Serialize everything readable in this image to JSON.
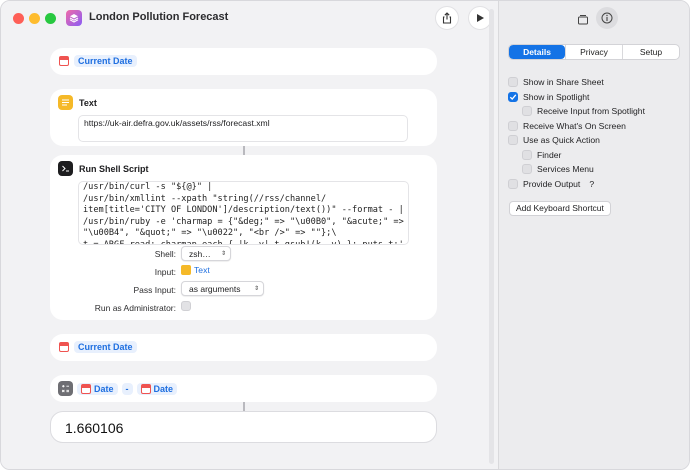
{
  "window": {
    "title": "London Pollution Forecast"
  },
  "actions": {
    "current_date_1": {
      "label": "Current Date"
    },
    "text": {
      "title": "Text",
      "value": "https://uk-air.defra.gov.uk/assets/rss/forecast.xml"
    },
    "shell": {
      "title": "Run Shell Script",
      "script": "/usr/bin/curl -s \"${@}\" |\n/usr/bin/xmllint --xpath \"string(//rss/channel/\nitem[title='CITY OF LONDON']/description/text())\" --format - |\n/usr/bin/ruby -e 'charmap = {\"&deg;\" => \"\\u00B0\", \"&acute;\" =>\n\"\\u00B4\", \"&quot;\" => \"\\u0022\", \"<br />\" => \"\"};\\\nt = ARGF.read; charmap.each { |k, v| t.gsub!(k, v) }; puts t;'",
      "shell_label": "Shell:",
      "shell_value": "zsh…",
      "input_label": "Input:",
      "input_value": "Text",
      "pass_label": "Pass Input:",
      "pass_value": "as arguments",
      "admin_label": "Run as Administrator:"
    },
    "current_date_2": {
      "label": "Current Date"
    },
    "calc": {
      "left": "Date",
      "operator": "-",
      "right": "Date"
    },
    "result": {
      "value": "1.660106"
    }
  },
  "sidebar": {
    "tabs": [
      "Details",
      "Privacy",
      "Setup"
    ],
    "options": {
      "share_sheet": {
        "label": "Show in Share Sheet",
        "checked": false
      },
      "spotlight": {
        "label": "Show in Spotlight",
        "checked": true
      },
      "receive_spotlight": {
        "label": "Receive Input from Spotlight",
        "checked": false
      },
      "onscreen": {
        "label": "Receive What's On Screen",
        "checked": false
      },
      "quick_action": {
        "label": "Use as Quick Action",
        "checked": false
      },
      "finder": {
        "label": "Finder",
        "checked": false
      },
      "services": {
        "label": "Services Menu",
        "checked": false
      },
      "provide_output": {
        "label": "Provide Output",
        "checked": false
      }
    },
    "help": "?",
    "add_shortcut": "Add Keyboard Shortcut"
  }
}
